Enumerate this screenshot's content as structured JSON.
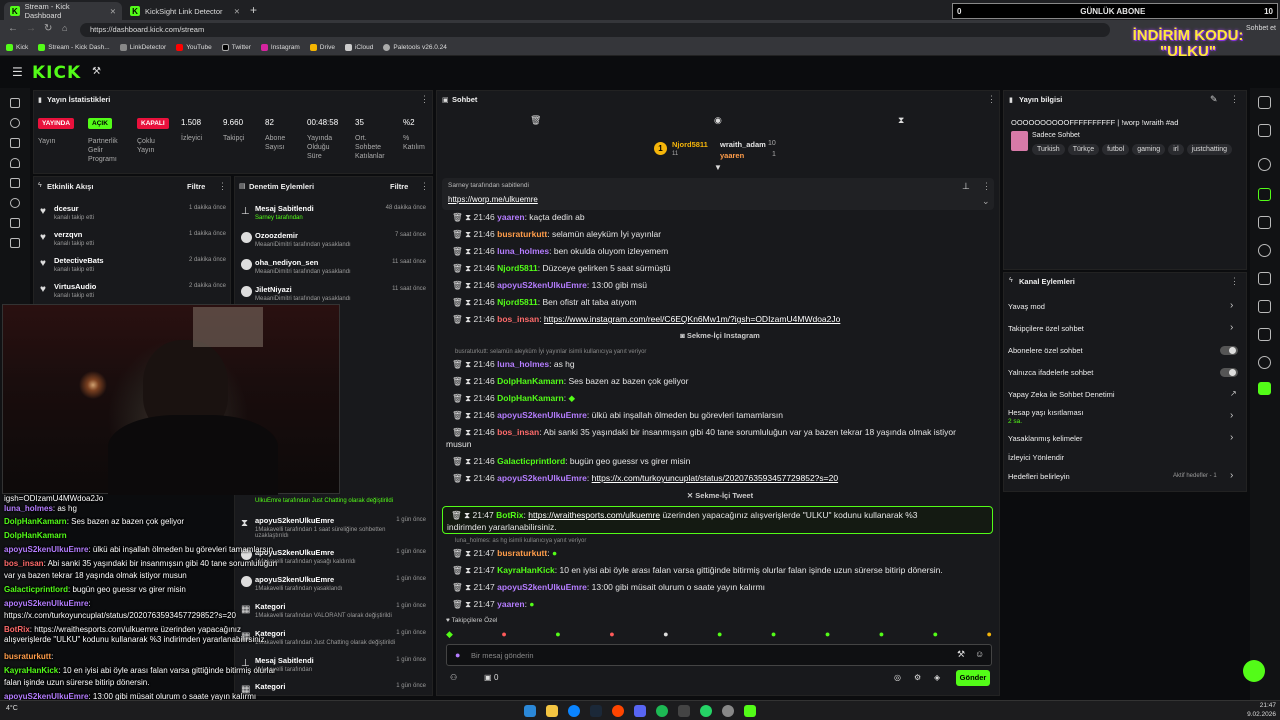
{
  "browser": {
    "tabs": [
      {
        "label": "Stream - Kick Dashboard"
      },
      {
        "label": "KickSight Link Detector"
      }
    ],
    "url": "https://dashboard.kick.com/stream",
    "bookmarks": [
      "Kick",
      "Stream - Kick Dash...",
      "LinkDetector",
      "YouTube",
      "Twitter",
      "Instagram",
      "Drive",
      "iCloud",
      "Paletools v26.0.24"
    ],
    "profile_label": "Sohbet et",
    "overlay": {
      "left": "0",
      "title": "GÜNLÜK ABONE",
      "right": "10"
    },
    "promo": {
      "line1": "İNDİRİM KODU:",
      "line2": "\"ULKU\""
    }
  },
  "kick": {
    "logo": "KICK"
  },
  "stats": {
    "title": "Yayın İstatistikleri",
    "badges": [
      {
        "label": "YAYINDA",
        "color": "#e9113c"
      },
      {
        "label": "AÇIK",
        "color": "#53fc18"
      },
      {
        "label": "KAPALI",
        "color": "#e9113c"
      }
    ],
    "badge_captions": [
      "Yayın",
      "Partnerlik Gelir Programı",
      "Çoklu Yayın"
    ],
    "values": [
      {
        "v": "1.508",
        "l": "İzleyici"
      },
      {
        "v": "9.660",
        "l": "Takipçi"
      },
      {
        "v": "82",
        "l": "Abone Sayısı"
      },
      {
        "v": "00:48:58",
        "l": "Yayında Olduğu Süre"
      },
      {
        "v": "35",
        "l": "Ort. Sohbete Katılanlar"
      },
      {
        "v": "%2",
        "l": "% Katılım"
      }
    ]
  },
  "activity": {
    "title": "Etkinlik Akışı",
    "filter": "Filtre",
    "items": [
      {
        "name": "dcesur",
        "sub": "kanalı takip etti",
        "time": "1 dakika önce"
      },
      {
        "name": "verzqvn",
        "sub": "kanalı takip etti",
        "time": "1 dakika önce"
      },
      {
        "name": "DetectiveBats",
        "sub": "kanalı takip etti",
        "time": "2 dakika önce"
      },
      {
        "name": "VirtusAudio",
        "sub": "kanalı takip etti",
        "time": "2 dakika önce"
      }
    ]
  },
  "mod": {
    "title": "Denetim Eylemleri",
    "filter": "Filtre",
    "items": [
      {
        "name": "Mesaj Sabitlendi",
        "sub": "Sarney tarafından",
        "time": "48 dakika önce"
      },
      {
        "name": "Ozoozdemir",
        "sub": "MeaaniDimitri tarafından yasaklandı",
        "time": "7 saat önce"
      },
      {
        "name": "oha_nediyon_sen",
        "sub": "MeaaniDimitri tarafından yasaklandı",
        "time": "11 saat önce"
      },
      {
        "name": "JiletNiyazi",
        "sub": "MeaaniDimitri tarafından yasaklandı",
        "time": "11 saat önce"
      }
    ],
    "lower": [
      {
        "name": "apoyuS2kenUlkuEmre",
        "sub": "1Makavelli tarafından 1 saat süreliğine sohbetten uzaklaştırıldı",
        "time": "1 gün önce"
      },
      {
        "name": "apoyuS2kenUlkuEmre",
        "sub": "1Makavelli tarafından yasağı kaldırıldı",
        "time": "1 gün önce"
      },
      {
        "name": "apoyuS2kenUlkuEmre",
        "sub": "1Makavelli tarafından yasaklandı",
        "time": "1 gün önce"
      },
      {
        "name": "Kategori",
        "sub": "1Makavelli tarafından VALORANT olarak değiştirildi",
        "time": "1 gün önce"
      },
      {
        "name": "Kategori",
        "sub": "1Makavelli tarafından Just Chatting olarak değiştirildi",
        "time": "1 gün önce"
      },
      {
        "name": "Mesaj Sabitlendi",
        "sub": "1Makavelli tarafından",
        "time": "1 gün önce"
      },
      {
        "name": "Kategori",
        "sub": "",
        "time": "1 gün önce"
      }
    ],
    "cut_note": "UlkuEmre tarafından Just Chatting olarak değiştirildi"
  },
  "chat": {
    "title": "Sohbet",
    "top_users": [
      {
        "name": "Njord5811",
        "count": "11"
      },
      {
        "name": "wraith_adam",
        "count": "10"
      },
      {
        "name": "yaaren",
        "count": "1"
      }
    ],
    "pinned": {
      "by": "Sarney tarafından sabitlendi",
      "link": "https://worp.me/ulkuemre"
    },
    "messages": [
      {
        "time": "21:46",
        "user": "yaaren",
        "cls": "u-purple",
        "text": "kaçta dedin ab"
      },
      {
        "time": "21:46",
        "user": "busraturkutt",
        "cls": "u-orange",
        "text": "selamün aleyküm İyi yayınlar"
      },
      {
        "time": "21:46",
        "user": "luna_holmes",
        "cls": "u-purple",
        "text": "ben okulda oluyom izleyemem"
      },
      {
        "time": "21:46",
        "user": "Njord5811",
        "cls": "u-green",
        "text": "Düzceye gelirken 5 saat sürmüştü"
      },
      {
        "time": "21:46",
        "user": "apoyuS2kenUlkuEmre",
        "cls": "u-purple",
        "text": "13:00 gibi msü"
      },
      {
        "time": "21:46",
        "user": "Njord5811",
        "cls": "u-green",
        "text": "Ben ofistr alt taba atıyom"
      },
      {
        "time": "21:46",
        "user": "bos_insan",
        "cls": "u-red",
        "text": "https://www.instagram.com/reel/C6EQKn6Mw1m/?igsh=ODIzamU4MWdoa2Jo"
      }
    ],
    "divider1": "Sekme-İçi Instagram",
    "reply1": "busraturkutt: selamün aleyküm İyi yayınlar isimli kullanıcıya yanıt veriyor",
    "messages2": [
      {
        "time": "21:46",
        "user": "luna_holmes",
        "cls": "u-purple",
        "text": "as hg"
      },
      {
        "time": "21:46",
        "user": "DolpHanKamarn",
        "cls": "u-green",
        "text": "Ses bazen az bazen çok geliyor"
      },
      {
        "time": "21:46",
        "user": "DolpHanKamarn",
        "cls": "u-green",
        "text": ""
      },
      {
        "time": "21:46",
        "user": "apoyuS2kenUlkuEmre",
        "cls": "u-purple",
        "text": "ülkü abi inşallah ölmeden bu görevleri tamamlarsın"
      },
      {
        "time": "21:46",
        "user": "bos_insan",
        "cls": "u-red",
        "text": "Abi sanki 35 yaşındaki bir insanmışsın gibi 40 tane sorumluluğun var ya bazen tekrar 18 yaşında olmak istiyor"
      },
      {
        "time": "21:46",
        "user": "Galacticprintlord",
        "cls": "u-green",
        "text": "bugün geo guessr vs girer misin"
      },
      {
        "time": "21:46",
        "user": "apoyuS2kenUlkuEmre",
        "cls": "u-purple",
        "text": "https://x.com/turkoyuncuplat/status/2020763593457729852?s=20"
      }
    ],
    "msg_wrap": "musun",
    "divider2": "Sekme-İçi Tweet",
    "bot": {
      "time": "21:47",
      "user": "BotRix",
      "link": "https://wraithesports.com/ulkuemre",
      "text": "üzerinden yapacağınız alışverişlerde \"ULKU\" kodunu kullanarak %3",
      "text2": "indirimden yararlanabilirsiniz."
    },
    "reply2": "luna_holmes: as hg isimli kullanıcıya yanıt veriyor",
    "messages3": [
      {
        "time": "21:47",
        "user": "busraturkutt",
        "cls": "u-orange",
        "text": ""
      },
      {
        "time": "21:47",
        "user": "KayraHanKick",
        "cls": "u-green",
        "text": "10 en iyisi abi öyle arası falan varsa gittiğinde bitirmiş olurlar falan işinde uzun sürerse bitirip dönersin."
      },
      {
        "time": "21:47",
        "user": "apoyuS2kenUlkuEmre",
        "cls": "u-purple",
        "text": "13:00 gibi müsait olurum o saate yayın kalırmı"
      },
      {
        "time": "21:47",
        "user": "yaaren",
        "cls": "u-purple",
        "text": ""
      }
    ],
    "followers_only": "Takipçilere Özel",
    "input_placeholder": "Bir mesaj gönderin",
    "send": "Gönder",
    "count": "0"
  },
  "info": {
    "title": "Yayın bilgisi",
    "stream_title": "OOOOOOOOOOFFFFFFFFFF | !worp !wraith #ad",
    "category": "Sadece Sohbet",
    "tags": [
      "Turkish",
      "Türkçe",
      "futbol",
      "gaming",
      "irl",
      "justchatting"
    ]
  },
  "actions": {
    "title": "Kanal Eylemleri",
    "items": [
      {
        "label": "Yavaş mod",
        "kind": "chev"
      },
      {
        "label": "Takipçilere özel sohbet",
        "kind": "chev"
      },
      {
        "label": "Abonelere özel sohbet",
        "kind": "toggle"
      },
      {
        "label": "Yalnızca ifadelerle sohbet",
        "kind": "toggle"
      },
      {
        "label": "Yapay Zeka ile Sohbet Denetimi",
        "kind": "ext"
      },
      {
        "label": "Hesap yaşı kısıtlaması",
        "sub": "2 sa.",
        "kind": "chev"
      },
      {
        "label": "Yasaklanmış kelimeler",
        "kind": "chev"
      },
      {
        "label": "İzleyici Yönlendir",
        "kind": "none"
      },
      {
        "label": "Hedefleri belirleyin",
        "side": "Aktif hedefler - 1",
        "kind": "chev"
      }
    ]
  },
  "video_overlay": [
    {
      "user": "",
      "text": "igsh=ODIzamU4MWdoa2Jo"
    },
    {
      "user": "luna_holmes",
      "text": ": as hg"
    },
    {
      "user": "DolpHanKamarn",
      "text": ": Ses bazen az bazen çok geliyor"
    },
    {
      "user": "DolpHanKamarn",
      "text": ""
    },
    {
      "user": "apoyuS2kenUlkuEmre",
      "text": ": ülkü abi inşallah ölmeden bu görevleri tamamlarsın"
    },
    {
      "user": "bos_insan",
      "text": ": Abi sanki 35 yaşındaki bir insanmışsın gibi 40 tane sorumluluğun"
    },
    {
      "user": "",
      "text": "var ya bazen tekrar 18 yaşında olmak istiyor musun"
    },
    {
      "user": "Galacticprintlord",
      "text": ": bugün geo guessr vs girer misin"
    },
    {
      "user": "apoyuS2kenUlkuEmre",
      "text": ":"
    },
    {
      "user": "",
      "text": "https://x.com/turkoyuncuplat/status/2020763593457729852?s=20"
    },
    {
      "user": "BotRix",
      "text": ": https://wraithesports.com/ulkuemre üzerinden yapacağınız"
    },
    {
      "user": "",
      "text": "alışverişlerde \"ULKU\" kodunu kullanarak %3 indirimden yararlanabilirsiniz."
    },
    {
      "user": "busraturkutt",
      "text": ":"
    },
    {
      "user": "KayraHanKick",
      "text": ": 10 en iyisi abi öyle arası falan varsa gittiğinde bitirmiş olurlar"
    },
    {
      "user": "",
      "text": "falan işinde uzun sürerse bitirip dönersin."
    },
    {
      "user": "apoyuS2kenUlkuEmre",
      "text": ": 13:00 gibi müsait olurum o saate yayın kalırmı"
    },
    {
      "user": "yaaren",
      "text": ":"
    }
  ],
  "taskbar": {
    "time": "21:47",
    "date": "9.02.2026",
    "temp": "4°C"
  }
}
